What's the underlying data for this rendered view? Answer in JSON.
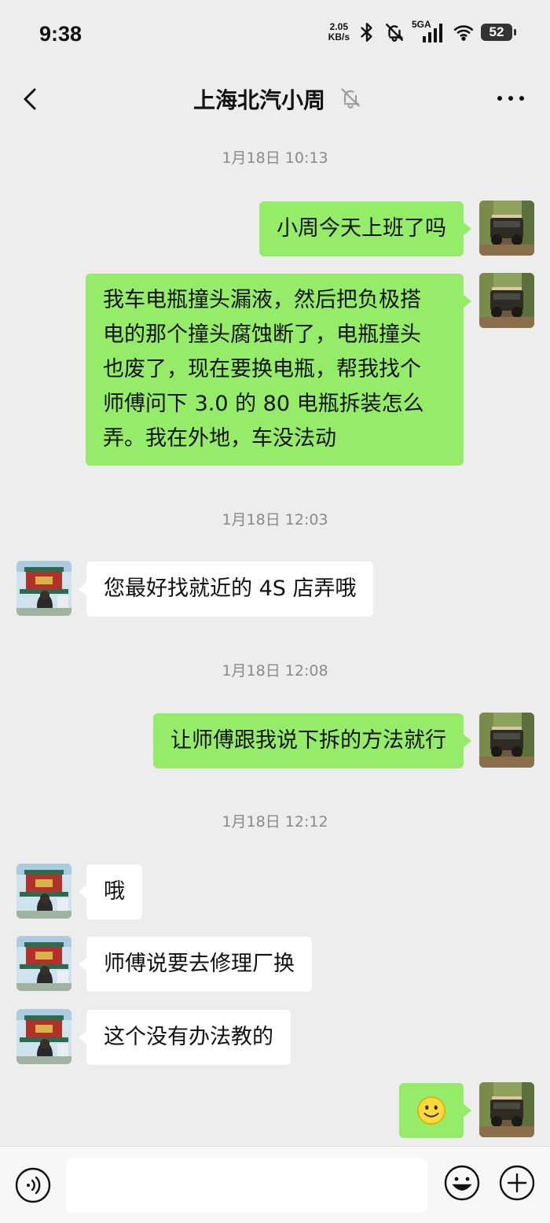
{
  "status_bar": {
    "time": "9:38",
    "net_speed_value": "2.05",
    "net_speed_unit": "KB/s",
    "network": "5GA",
    "battery": "52",
    "icons": [
      "bluetooth-icon",
      "mute-bell-icon",
      "signal-icon",
      "wifi-icon",
      "battery-icon"
    ]
  },
  "header": {
    "title": "上海北汽小周",
    "muted_icon": "bell-off-icon",
    "back_icon": "chevron-left-icon",
    "more_icon": "more-horizontal-icon"
  },
  "messages": {
    "ts1": "1月18日 10:13",
    "m1": "小周今天上班了吗",
    "m2": [
      "我车电瓶撞头漏液，然后把负极搭",
      "电的那个撞头腐蚀断了，电瓶撞头",
      "也废了，现在要换电瓶，帮我找个",
      "师傅问下 3.0 的 80 电瓶拆装怎么",
      "弄。我在外地，车没法动"
    ],
    "ts2": "1月18日 12:03",
    "m3": "您最好找就近的 4S 店弄哦",
    "ts3": "1月18日 12:08",
    "m4": "让师傅跟我说下拆的方法就行",
    "ts4": "1月18日 12:12",
    "m5": "哦",
    "m6": "师傅说要去修理厂换",
    "m7": "这个没有办法教的",
    "m8_emoji": "smile-emoji"
  },
  "input_bar": {
    "value": "",
    "icons": [
      "voice-icon",
      "emoji-icon",
      "plus-icon"
    ]
  },
  "colors": {
    "background": "#ededed",
    "my_bubble": "#95ec69",
    "their_bubble": "#ffffff",
    "timestamp": "#8a8a8a"
  }
}
